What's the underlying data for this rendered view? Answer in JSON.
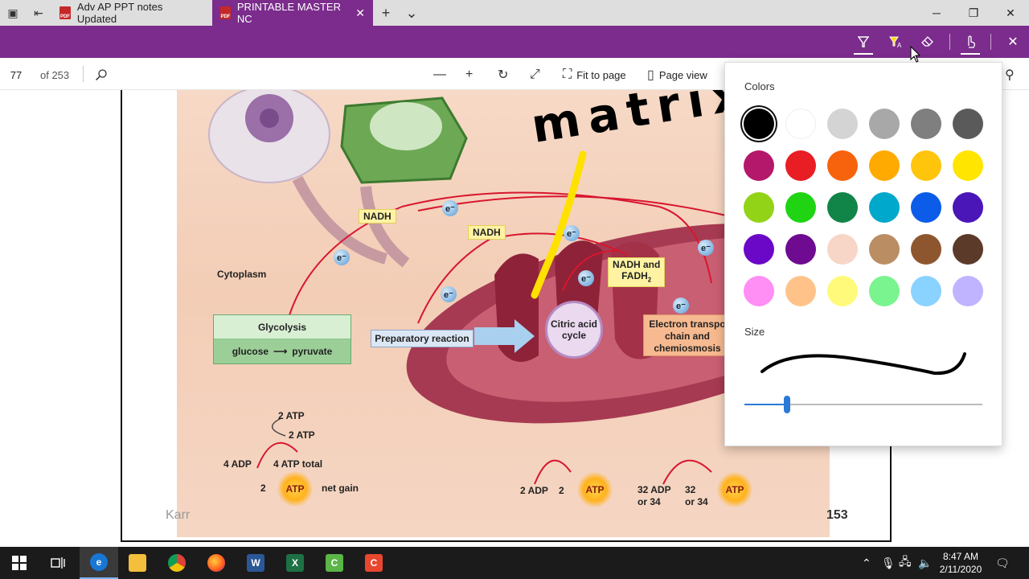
{
  "tabbar": {
    "tabs": [
      {
        "label": "Adv AP PPT notes Updated",
        "icon": "pdf-icon",
        "active": false
      },
      {
        "label": "PRINTABLE MASTER NC",
        "icon": "pdf-icon",
        "active": true
      }
    ],
    "icon_text": "PDF",
    "close_glyph": "✕",
    "new_tab_glyph": "+",
    "tab_menu_glyph": "⌄"
  },
  "window_controls": {
    "minimize": "─",
    "restore": "❐",
    "close": "✕"
  },
  "ink_toolbar": {
    "accent_color": "#7b2c8c",
    "tools": [
      "draw-icon",
      "highlight-icon",
      "eraser-icon",
      "touch-writing-icon",
      "close-icon"
    ],
    "close_glyph": "✕"
  },
  "pdf_toolbar": {
    "current_page": "77",
    "page_count": "of 253",
    "fit_to_page": "Fit to page",
    "page_view": "Page view"
  },
  "slide": {
    "labels": {
      "cytoplasm": "Cytoplasm",
      "nadh_1": "NADH",
      "nadh_2": "NADH",
      "nadh_fadh_1": "NADH and",
      "nadh_fadh_2": "FADH",
      "fadh_sub": "2",
      "electron": "e⁻",
      "glycolysis": "Glycolysis",
      "glucose": "glucose",
      "pyruvate": "pyruvate",
      "preparatory": "Preparatory reaction",
      "citric_1": "Citric acid",
      "citric_2": "cycle",
      "etc_1": "Electron transpo",
      "etc_2": "chain and",
      "etc_3": "chemiosmosis",
      "atp_2a": "2 ATP",
      "atp_2b": "2 ATP",
      "adp_4": "4 ADP",
      "atp_4_total": "4 ATP total",
      "two_net": "2",
      "net_gain": "net gain",
      "adp_2": "2 ADP",
      "two_mid": "2",
      "adp_32_1": "32 ADP",
      "adp_32_2": "or 34",
      "n32_1": "32",
      "n32_2": "or 34",
      "atp": "ATP"
    },
    "handwriting": "matrix",
    "footer_left": "Karr",
    "footer_right": "153"
  },
  "ink_panel": {
    "colors_title": "Colors",
    "size_title": "Size",
    "size_fraction": 0.18,
    "selected_color": "#000000",
    "colors": [
      "#000000",
      "#ffffff",
      "#d4d4d4",
      "#a8a8a8",
      "#7f7f7f",
      "#5a5a5a",
      "#b4186a",
      "#e81e24",
      "#f7630c",
      "#ffaa00",
      "#ffc50d",
      "#ffe500",
      "#92d318",
      "#20d414",
      "#118547",
      "#00a8cc",
      "#0c5ce9",
      "#4a16b8",
      "#6b08c7",
      "#6e0b90",
      "#f7d6c7",
      "#bb8d63",
      "#8e562e",
      "#5c3a2a",
      "#ff8ef5",
      "#ffc38a",
      "#fffa7a",
      "#7af48e",
      "#8ad2ff",
      "#c0b3ff"
    ]
  },
  "taskbar": {
    "apps": [
      "windows-start-icon",
      "task-view-icon",
      "edge-icon",
      "file-explorer-icon",
      "chrome-icon",
      "firefox-icon",
      "word-icon",
      "excel-icon",
      "camtasia-green-icon",
      "camtasia-orange-icon"
    ],
    "time": "8:47 AM",
    "date": "2/11/2020"
  }
}
